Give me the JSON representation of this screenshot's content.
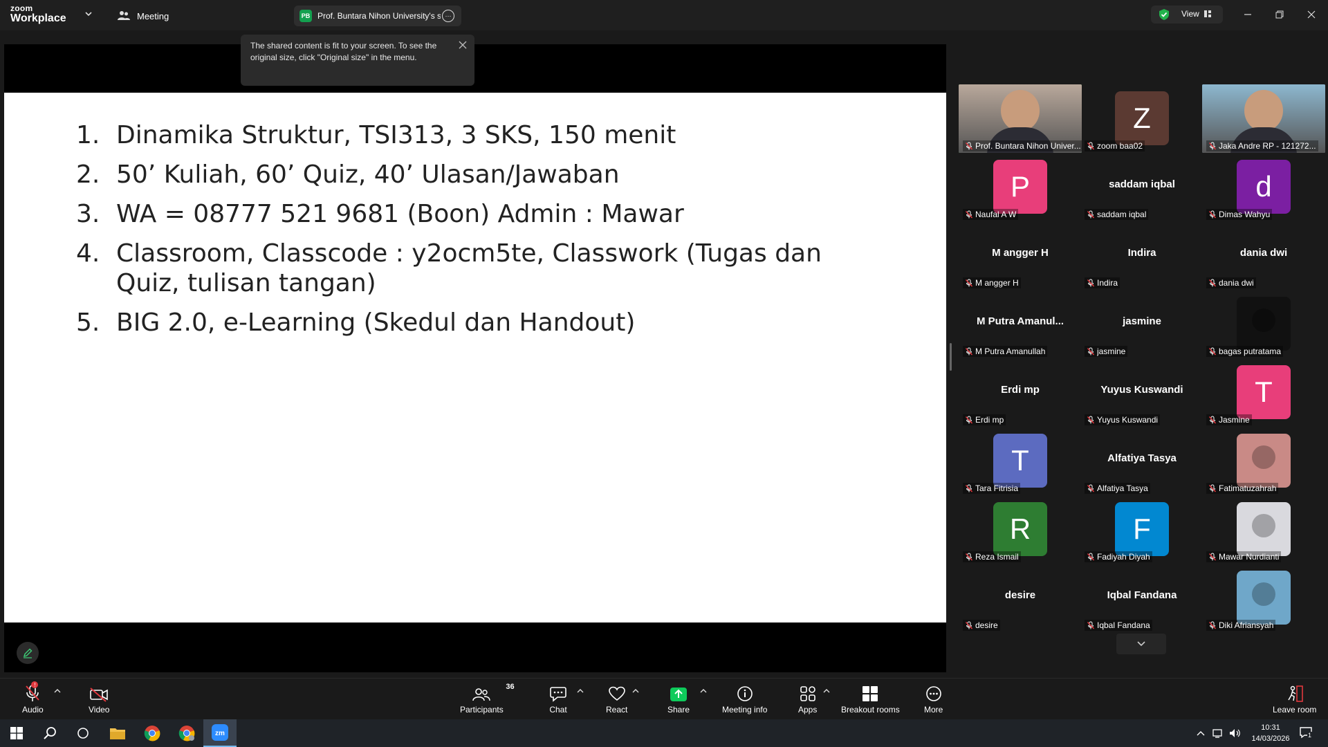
{
  "app": {
    "logo_line1": "zoom",
    "logo_line2": "Workplace"
  },
  "header": {
    "meeting_label": "Meeting",
    "share_badge": "PB",
    "share_title": "Prof. Buntara Nihon University's s",
    "view_label": "View"
  },
  "tooltip": {
    "text": "The shared content is fit to your screen. To see the original size, click \"Original size\" in the menu."
  },
  "slide": {
    "items": [
      {
        "num": "1.",
        "text": "Dinamika Struktur, TSI313, 3 SKS, 150 menit"
      },
      {
        "num": "2.",
        "text": "50’ Kuliah, 60’ Quiz, 40’ Ulasan/Jawaban"
      },
      {
        "num": "3.",
        "text": "WA = 08777 521 9681 (Boon) Admin : Mawar"
      },
      {
        "num": "4.",
        "text": "Classroom, Classcode : y2ocm5te, Classwork (Tugas dan Quiz, tulisan tangan)"
      },
      {
        "num": "5.",
        "text": "BIG 2.0, e-Learning (Skedul dan Handout)"
      }
    ]
  },
  "gallery": {
    "tiles": [
      {
        "kind": "video",
        "label": "Prof. Buntara Nihon Univer...",
        "active": true,
        "bg": "#b9a89b"
      },
      {
        "kind": "avatar",
        "letter": "Z",
        "label": "zoom baa02",
        "color": "#5b3a32"
      },
      {
        "kind": "video",
        "label": "Jaka Andre RP - 121272...",
        "bg": "#8db8cf"
      },
      {
        "kind": "avatar",
        "letter": "P",
        "label": "Naufal A W",
        "color": "#e83e7a"
      },
      {
        "kind": "name",
        "big": "saddam iqbal",
        "label": "saddam iqbal"
      },
      {
        "kind": "avatar",
        "letter": "d",
        "label": "Dimas Wahyu",
        "color": "#7b1fa2"
      },
      {
        "kind": "name",
        "big": "M angger H",
        "label": "M angger H"
      },
      {
        "kind": "name",
        "big": "Indira",
        "label": "Indira"
      },
      {
        "kind": "name",
        "big": "dania dwi",
        "label": "dania dwi"
      },
      {
        "kind": "name",
        "big": "M Putra Amanul...",
        "label": "M Putra Amanullah"
      },
      {
        "kind": "name",
        "big": "jasmine",
        "label": "jasmine"
      },
      {
        "kind": "photo",
        "label": "bagas putratama",
        "bg": "#111111"
      },
      {
        "kind": "name",
        "big": "Erdi mp",
        "label": "Erdi mp"
      },
      {
        "kind": "name",
        "big": "Yuyus Kuswandi",
        "label": "Yuyus Kuswandi"
      },
      {
        "kind": "avatar",
        "letter": "T",
        "label": "Jasmine",
        "color": "#e83e7a"
      },
      {
        "kind": "avatar",
        "letter": "T",
        "label": "Tara Fitrisia",
        "color": "#5c6bc0"
      },
      {
        "kind": "name",
        "big": "Alfatiya Tasya",
        "label": "Alfatiya Tasya"
      },
      {
        "kind": "photo",
        "label": "Fatimatuzahrah",
        "bg": "#c98a86"
      },
      {
        "kind": "avatar",
        "letter": "R",
        "label": "Reza Ismail",
        "color": "#2e7d32"
      },
      {
        "kind": "avatar",
        "letter": "F",
        "label": "Fadiyah Diyah",
        "color": "#0288d1"
      },
      {
        "kind": "photo",
        "label": "Mawar Nurdianti",
        "bg": "#d9d9de"
      },
      {
        "kind": "name",
        "big": "desire",
        "label": "desire"
      },
      {
        "kind": "name",
        "big": "Iqbal Fandana",
        "label": "Iqbal Fandana"
      },
      {
        "kind": "photo",
        "label": "Diki Afriansyah",
        "bg": "#6fa7c9"
      }
    ]
  },
  "toolbar": {
    "audio": "Audio",
    "video": "Video",
    "participants": "Participants",
    "participants_count": "36",
    "chat": "Chat",
    "react": "React",
    "share": "Share",
    "meeting_info": "Meeting info",
    "apps": "Apps",
    "breakout": "Breakout rooms",
    "more": "More",
    "leave": "Leave room"
  },
  "taskbar": {
    "time": "10:31",
    "date": "14/03/2026",
    "notif_count": "1"
  },
  "colors": {
    "active_border": "#4cc86b",
    "share_green": "#0ecb5b",
    "muted_red": "#e0383e"
  }
}
